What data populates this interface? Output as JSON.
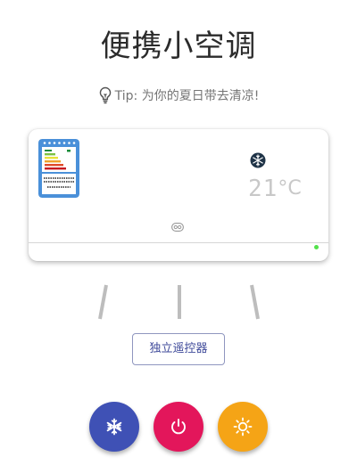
{
  "page": {
    "title": "便携小空调",
    "tip": "Tip: 为你的夏日带去清凉!"
  },
  "ac_unit": {
    "temperature": "21",
    "temperature_unit": "°C",
    "mode_icon": "snowflake-icon",
    "status_led_color": "#52e24a"
  },
  "remote": {
    "label": "独立遥控器"
  },
  "controls": {
    "cool": {
      "icon": "snowflake-icon",
      "color": "#3f51b5"
    },
    "power": {
      "icon": "power-icon",
      "color": "#e3165b"
    },
    "heat": {
      "icon": "sun-icon",
      "color": "#f5a416"
    }
  }
}
